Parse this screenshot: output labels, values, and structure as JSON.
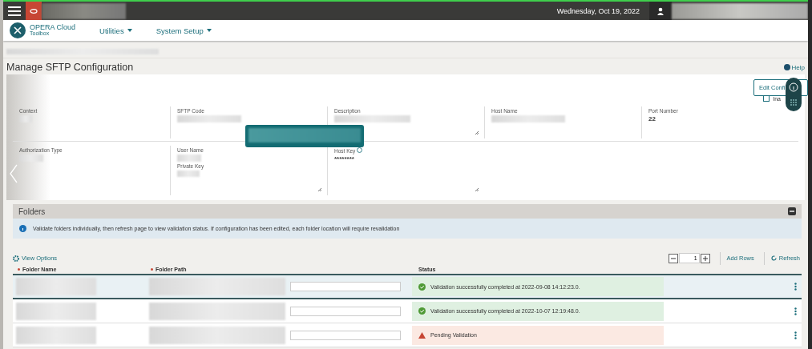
{
  "topbar": {
    "date": "Wednesday, Oct 19, 2022"
  },
  "nav": {
    "brand": "OPERA Cloud",
    "brand_sub": "Toolbox",
    "menus": [
      "Utilities",
      "System Setup"
    ]
  },
  "page": {
    "title": "Manage SFTP Configuration",
    "help": "Help"
  },
  "actions": {
    "edit_button": "Edit Confi",
    "inactive_label": "Ina",
    "inactive_checked": false
  },
  "fields": [
    {
      "label": "Context",
      "kind": "redacted"
    },
    {
      "label": "SFTP Code",
      "kind": "redacted"
    },
    {
      "label": "Description",
      "kind": "redacted-area"
    },
    {
      "label": "Host Name",
      "kind": "redacted"
    },
    {
      "label": "Port Number",
      "kind": "value",
      "value": "22"
    },
    {
      "label": "Authorization Type",
      "kind": "redacted"
    },
    {
      "label": "User Name",
      "kind": "redacted",
      "sub_label": "Private Key"
    },
    {
      "label": "Host Key",
      "kind": "secret",
      "value": "********"
    }
  ],
  "folders": {
    "title": "Folders",
    "expanded": true,
    "info": "Validate folders individually, then refresh page to view validation status. If configuration has been edited, each folder location will require revalidation",
    "view_options": "View Options",
    "stepper_value": "1",
    "add_rows": "Add Rows",
    "refresh": "Refresh",
    "columns": [
      {
        "label": "Folder Name",
        "required": true
      },
      {
        "label": "Folder Path",
        "required": true
      },
      {
        "label": "Status",
        "required": false
      }
    ],
    "rows": [
      {
        "selected": true,
        "status": "Validation successfully completed at 2022-09-08 14:12:23.0.",
        "kind": "success"
      },
      {
        "selected": false,
        "status": "Validation successfully completed at 2022-10-07 12:19:48.0.",
        "kind": "success"
      },
      {
        "selected": false,
        "status": "Pending Validation",
        "kind": "pending"
      }
    ]
  }
}
